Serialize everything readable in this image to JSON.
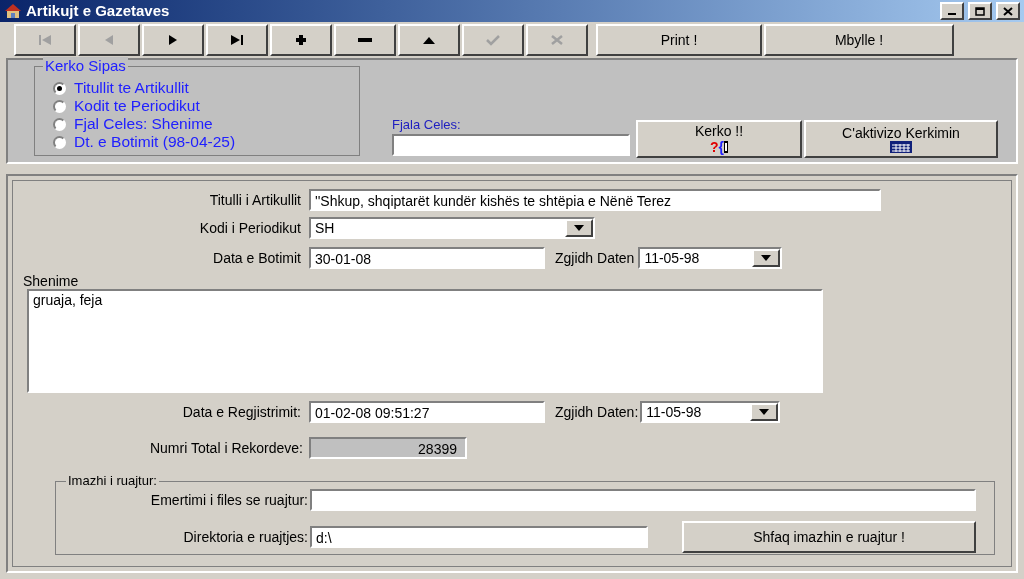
{
  "window": {
    "title": "Artikujt e Gazetaves"
  },
  "toolbar": [
    {
      "kind": "first",
      "disabled": true
    },
    {
      "kind": "prev",
      "disabled": true
    },
    {
      "kind": "next",
      "disabled": false
    },
    {
      "kind": "last",
      "disabled": false
    },
    {
      "kind": "add",
      "disabled": false
    },
    {
      "kind": "delete",
      "disabled": false
    },
    {
      "kind": "edit",
      "disabled": false
    },
    {
      "kind": "post",
      "disabled": true
    },
    {
      "kind": "cancel",
      "disabled": true
    }
  ],
  "toolbar_buttons": [
    "Print !",
    "Mbylle !"
  ],
  "search": {
    "title": "Kerko Sipas",
    "options": [
      {
        "label": "Titullit te Artikullit",
        "selected": true
      },
      {
        "label": "Kodit te Periodikut",
        "selected": false
      },
      {
        "label": "Fjal Celes: Shenime",
        "selected": false
      },
      {
        "label": "Dt. e Botimit (98-04-25)",
        "selected": false
      }
    ],
    "keyword_label": "Fjala Celes:",
    "search_button": {
      "label": "Kerko !!",
      "glyphs": [
        "?",
        "{"
      ]
    },
    "clear_button": "C'aktivizo Kerkimin"
  },
  "form": {
    "title_label": "Titulli i Artikullit",
    "title_value": "''Shkup, shqiptarët kundër kishës te shtëpia e Nënë Terez",
    "code_label": "Kodi i Periodikut",
    "code_value": "SH",
    "pub_date_label": "Data e Botimit",
    "pub_date_value": "30-01-08",
    "pick_date_label": "Zgjidh Daten",
    "pick_date_value": "11-05-98",
    "notes_label": "Shenime",
    "notes_value": "gruaja, feja",
    "reg_date_label": "Data e Regjistrimit:",
    "reg_date_value": "01-02-08 09:51:27",
    "pick_date_label_2": "Zgjidh Daten:",
    "pick_date_value_2": "11-05-98",
    "total_label": "Numri Total i Rekordeve:",
    "total_value": "28399"
  },
  "image_group": {
    "title": "Imazhi i ruajtur:",
    "file_label": "Emertimi i files se ruajtur:",
    "dir_label": "Direktoria e ruajtjes:",
    "dir_value": "d:\\",
    "show_button": "Shfaq imazhin e ruajtur !"
  }
}
